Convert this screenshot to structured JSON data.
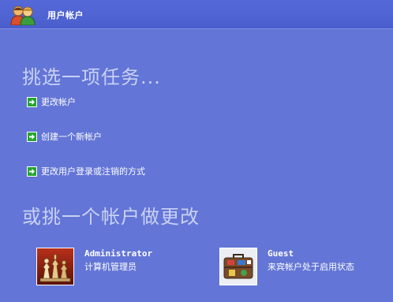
{
  "window": {
    "title": "用户帐户",
    "icon": "users-icon"
  },
  "sections": {
    "pick_task": "挑选一项任务...",
    "pick_account": "或挑一个帐户做更改"
  },
  "tasks": [
    {
      "label": "更改帐户",
      "icon": "green-arrow-icon"
    },
    {
      "label": "创建一个新帐户",
      "icon": "green-arrow-icon"
    },
    {
      "label": "更改用户登录或注销的方式",
      "icon": "green-arrow-icon"
    }
  ],
  "accounts": [
    {
      "name": "Administrator",
      "type": "计算机管理员",
      "picture": "chess-pieces-picture"
    },
    {
      "name": "Guest",
      "type": "来宾帐户处于启用状态",
      "picture": "suitcase-picture"
    }
  ],
  "colors": {
    "background": "#6375D6",
    "titlebar": "#4f63d2",
    "heading": "#c9d1f2",
    "arrow_green": "#24a52e"
  }
}
